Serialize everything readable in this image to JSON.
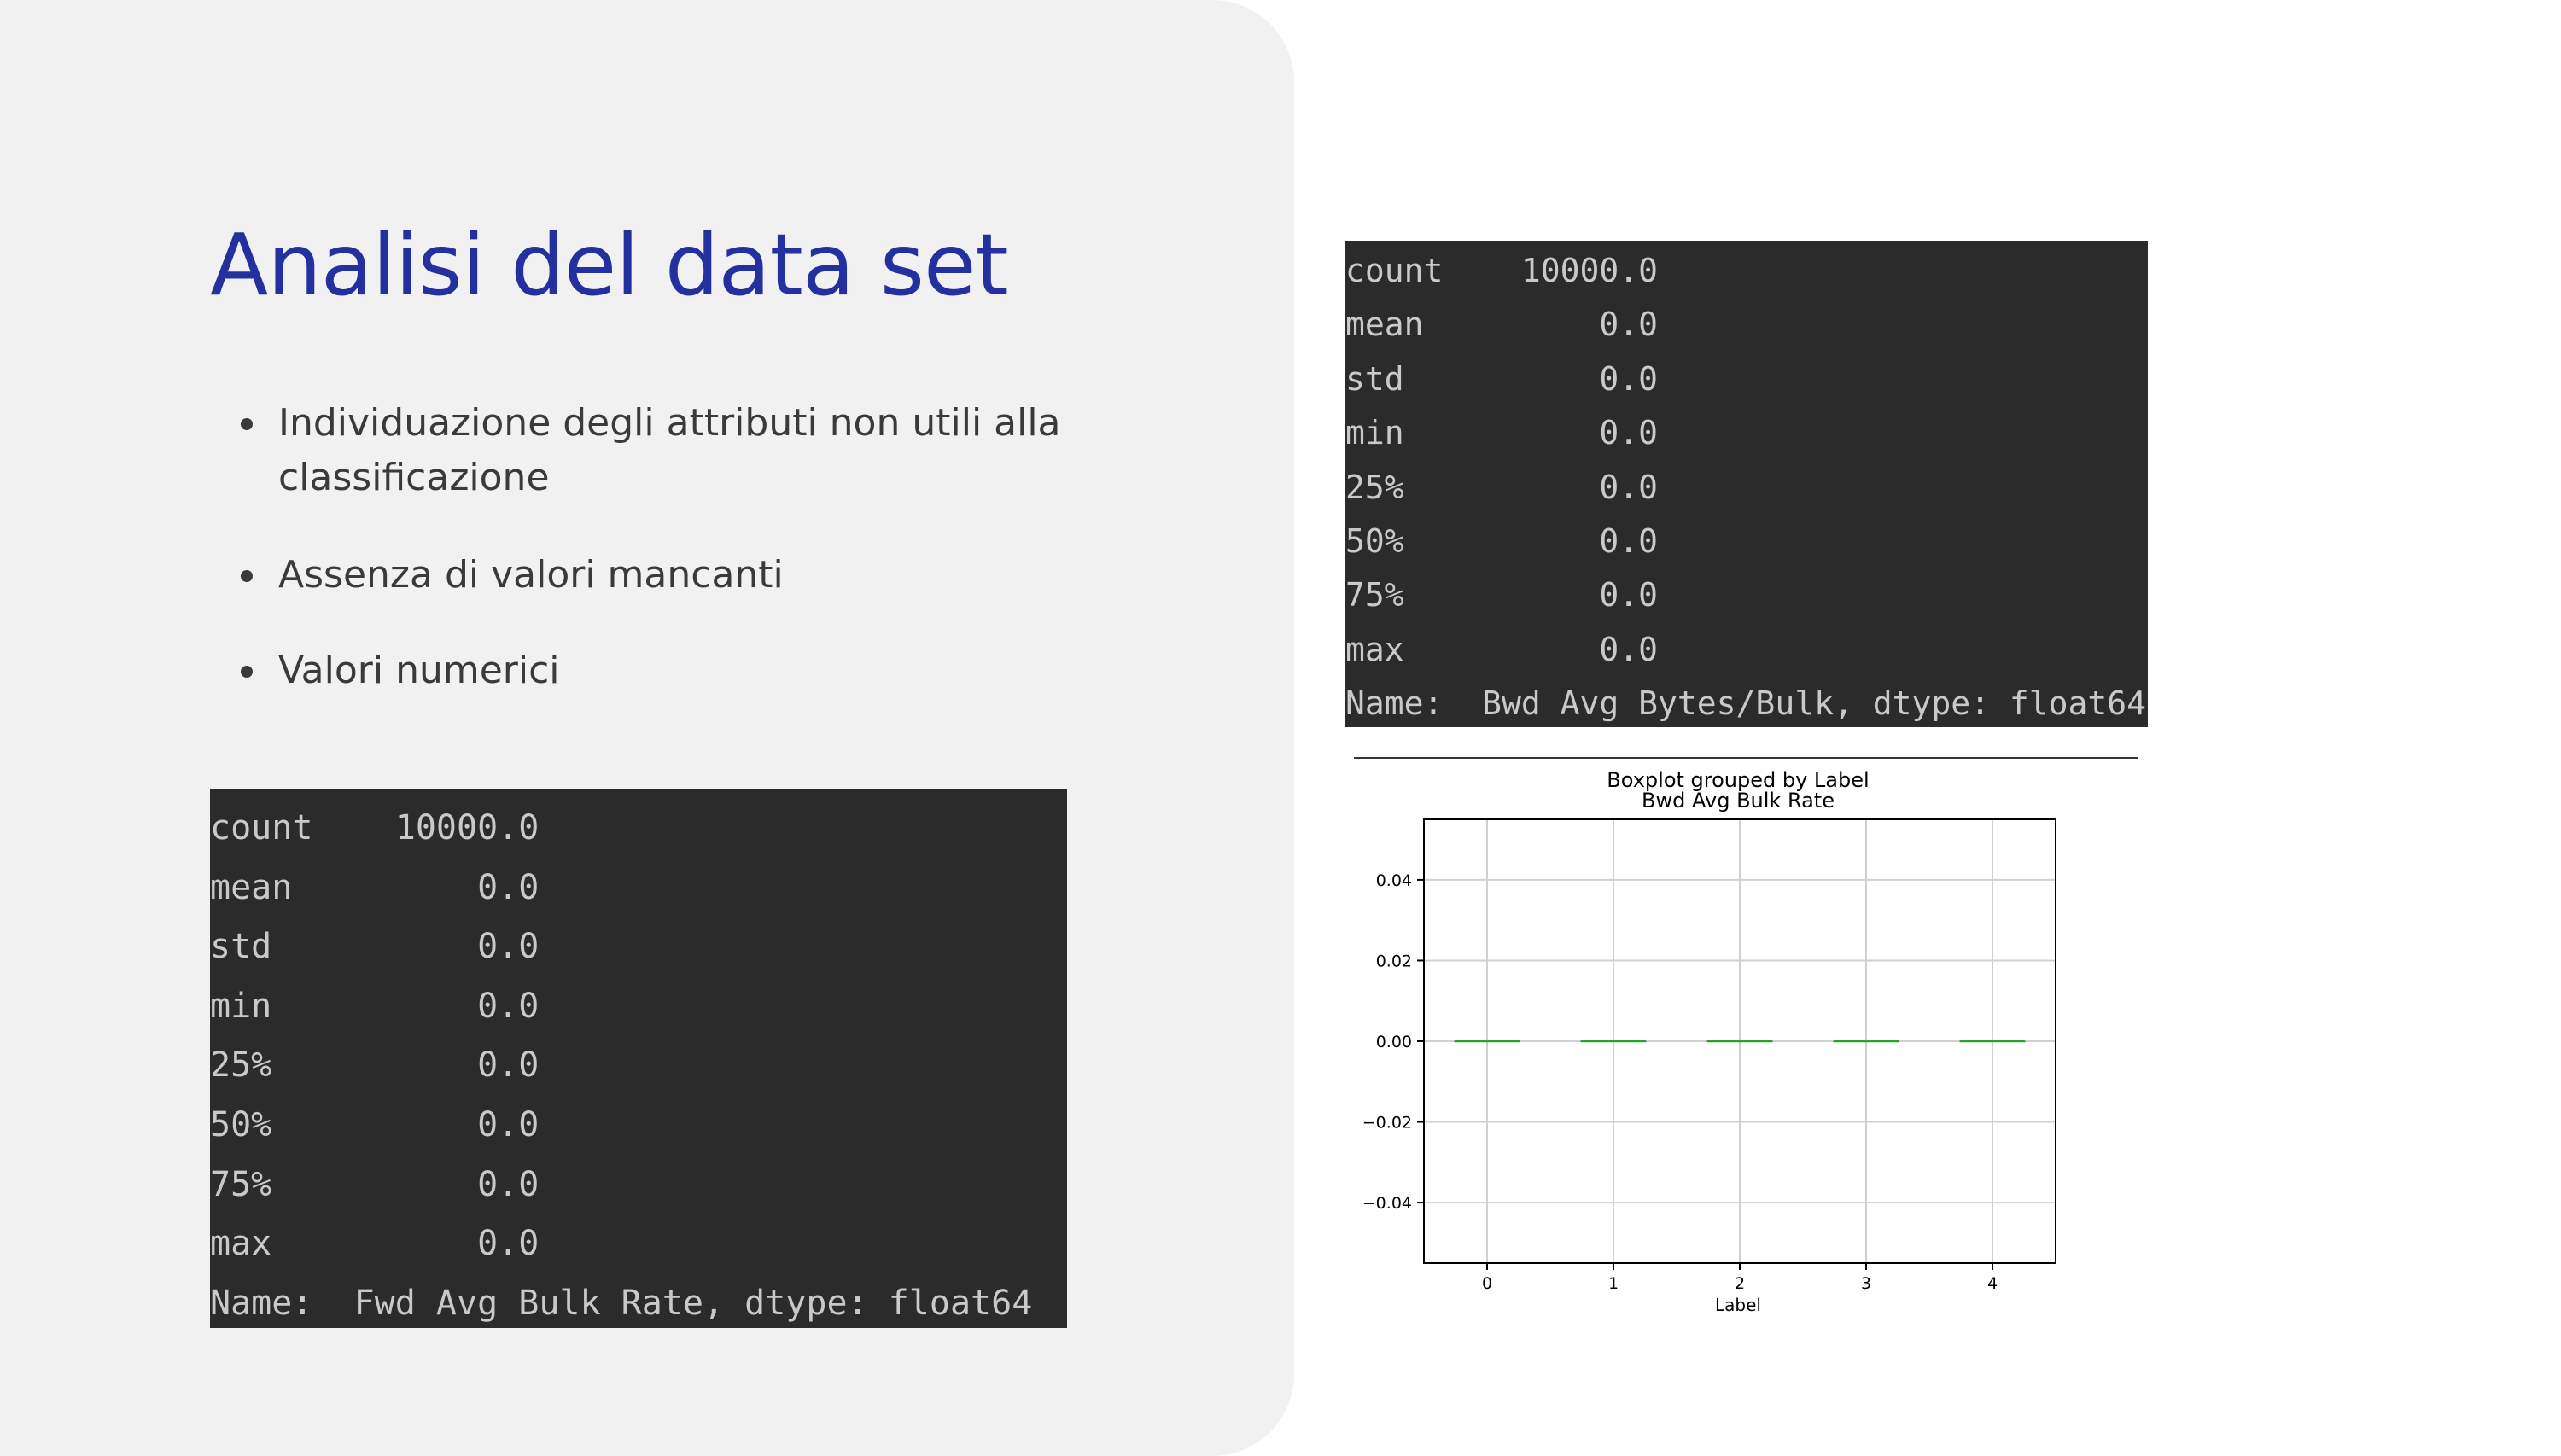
{
  "slide": {
    "title": "Analisi del data set",
    "bullets": [
      "Individuazione degli attributi non utili alla",
      "classificazione",
      "Assenza di valori mancanti",
      "Valori numerici"
    ]
  },
  "console_left": {
    "lines": [
      "count    10000.0",
      "mean         0.0",
      "std          0.0",
      "min          0.0",
      "25%          0.0",
      "50%          0.0",
      "75%          0.0",
      "max          0.0",
      "Name:  Fwd Avg Bulk Rate, dtype: float64"
    ]
  },
  "console_right": {
    "lines": [
      "count    10000.0",
      "mean         0.0",
      "std          0.0",
      "min          0.0",
      "25%          0.0",
      "50%          0.0",
      "75%          0.0",
      "max          0.0",
      "Name:  Bwd Avg Bytes/Bulk, dtype: float64"
    ]
  },
  "chart_data": {
    "type": "box",
    "suptitle": "Boxplot grouped by Label",
    "title": "Bwd Avg Bulk Rate",
    "xlabel": "Label",
    "ylabel": "",
    "categories": [
      "0",
      "1",
      "2",
      "3",
      "4"
    ],
    "median": [
      0.0,
      0.0,
      0.0,
      0.0,
      0.0
    ],
    "q1": [
      0.0,
      0.0,
      0.0,
      0.0,
      0.0
    ],
    "q3": [
      0.0,
      0.0,
      0.0,
      0.0,
      0.0
    ],
    "whisker_low": [
      0.0,
      0.0,
      0.0,
      0.0,
      0.0
    ],
    "whisker_high": [
      0.0,
      0.0,
      0.0,
      0.0,
      0.0
    ],
    "ylim": [
      -0.055,
      0.055
    ],
    "yticks": [
      -0.04,
      -0.02,
      0.0,
      0.02,
      0.04
    ],
    "ytick_labels": [
      "−0.04",
      "−0.02",
      "0.00",
      "0.02",
      "0.04"
    ],
    "grid": true,
    "colors": {
      "median": "#2ca02c",
      "box": "#1f77b4"
    }
  }
}
